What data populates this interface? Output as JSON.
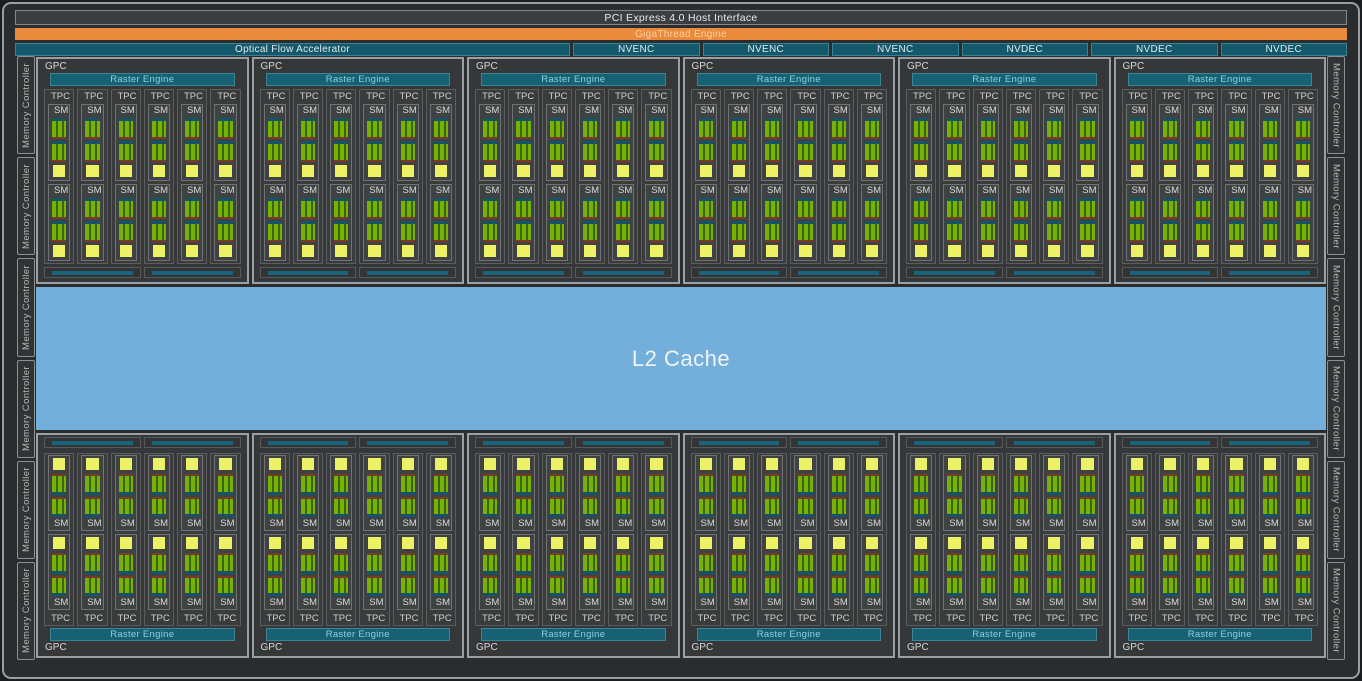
{
  "chip": {
    "host_interface": "PCI Express 4.0 Host Interface",
    "gigathread": "GigaThread Engine",
    "optical_flow": "Optical Flow Accelerator",
    "media_engines": [
      "NVENC",
      "NVENC",
      "NVENC",
      "NVDEC",
      "NVDEC",
      "NVDEC"
    ],
    "l2_cache": "L2 Cache",
    "memory_controller": "Memory Controller",
    "labels": {
      "gpc": "GPC",
      "raster_engine": "Raster Engine",
      "tpc": "TPC",
      "sm": "SM"
    },
    "counts": {
      "gpc_rows": 2,
      "gpcs_per_row": 6,
      "tpcs_per_gpc": 6,
      "sms_per_tpc": 2,
      "exec_blocks_per_sm": 2,
      "rop_bars_per_gpc": 2,
      "memory_controllers_per_side": 6
    },
    "colors": {
      "gigathread_orange": "#e98a3c",
      "engine_teal": "#14586b",
      "raster_teal": "#176175",
      "raster_text": "#8ad0e0",
      "core_green": "#74b203",
      "core_green_dark": "#3f6110",
      "register_yellow": "#edf164",
      "scheduler_teal": "#14546a",
      "divider_maroon": "#7a3a28",
      "l2_blue": "#74aedb",
      "frame_gray": "#9aa0a1",
      "background": "#2a2c2d"
    }
  }
}
